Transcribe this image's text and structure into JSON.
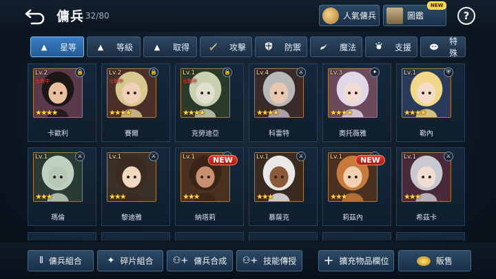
{
  "header": {
    "title": "傭兵",
    "count": "32/80",
    "popular_label": "人氣傭兵",
    "dictionary_label": "圖鑑",
    "new_tag": "NEW",
    "help_label": "?"
  },
  "tabs": [
    {
      "label": "星等",
      "icon": "arrow-up-icon",
      "active": true
    },
    {
      "label": "等級",
      "icon": "arrow-up-icon",
      "active": false
    },
    {
      "label": "取得",
      "icon": "arrow-up-icon",
      "active": false
    },
    {
      "label": "攻擊",
      "icon": "sword-icon",
      "active": false
    },
    {
      "label": "防禦",
      "icon": "shield-icon",
      "active": false
    },
    {
      "label": "魔法",
      "icon": "magic-icon",
      "active": false
    },
    {
      "label": "支援",
      "icon": "support-icon",
      "active": false
    },
    {
      "label": "特殊",
      "icon": "special-icon",
      "active": false
    }
  ],
  "cards": [
    {
      "name": "卡歐利",
      "level": "Lv.2",
      "status": "出戰中",
      "stars": 4,
      "role_icon": "lock-icon",
      "new": "",
      "hair": "#1c1616",
      "skin": "#e8c0a0",
      "bg": "#5a3a4a"
    },
    {
      "name": "賽爾",
      "level": "Lv.2",
      "status": "出戰中",
      "stars": 4,
      "role_icon": "lock-icon",
      "new": "",
      "hair": "#d8c890",
      "skin": "#f0d0b8",
      "bg": "#4a3028"
    },
    {
      "name": "克勞迪亞",
      "level": "Lv.1",
      "status": "出戰中",
      "stars": 4,
      "role_icon": "lock-icon",
      "new": "",
      "hair": "#c8d0b0",
      "skin": "#e0e0d0",
      "bg": "#2a3a2a"
    },
    {
      "name": "科雷特",
      "level": "Lv.4",
      "status": "",
      "stars": 4,
      "role_icon": "sword-icon",
      "new": "",
      "hair": "#b8b8b8",
      "skin": "#e8c8b0",
      "bg": "#3a2a2a"
    },
    {
      "name": "奧托薇雅",
      "level": "Lv.3",
      "status": "",
      "stars": 4,
      "role_icon": "magic-icon",
      "new": "",
      "hair": "#e0d8e8",
      "skin": "#f0dcd0",
      "bg": "#6a4a5a"
    },
    {
      "name": "勒內",
      "level": "Lv.1",
      "status": "",
      "stars": 4,
      "role_icon": "shield-icon",
      "new": "",
      "hair": "#f0d888",
      "skin": "#f4dcc8",
      "bg": "#2a3a5a"
    },
    {
      "name": "瑪倫",
      "level": "Lv.1",
      "status": "",
      "stars": 3,
      "role_icon": "sword-icon",
      "new": "",
      "hair": "#c0d0c0",
      "skin": "#b8c8b8",
      "bg": "#2a3a34"
    },
    {
      "name": "黎迪雅",
      "level": "Lv.1",
      "status": "",
      "stars": 3,
      "role_icon": "sword-icon",
      "new": "",
      "hair": "#3a2a20",
      "skin": "#f0d8c0",
      "bg": "#3a3028"
    },
    {
      "name": "納塔莉",
      "level": "Lv.1",
      "status": "",
      "stars": 3,
      "role_icon": "sword-icon",
      "new": "NEW",
      "hair": "#3a2418",
      "skin": "#c89070",
      "bg": "#4a3020"
    },
    {
      "name": "慕薩克",
      "level": "Lv.1",
      "status": "",
      "stars": 3,
      "role_icon": "sword-icon",
      "new": "",
      "hair": "#e8e8e8",
      "skin": "#8a5a3a",
      "bg": "#3a2a20"
    },
    {
      "name": "莉茲內",
      "level": "Lv.1",
      "status": "",
      "stars": 3,
      "role_icon": "sword-icon",
      "new": "NEW",
      "hair": "#c87a3a",
      "skin": "#f0d0b0",
      "bg": "#4a3020"
    },
    {
      "name": "希茲卡",
      "level": "Lv.1",
      "status": "",
      "stars": 3,
      "role_icon": "sword-icon",
      "new": "",
      "hair": "#c8c8d0",
      "skin": "#f0dcd0",
      "bg": "#4a2a3a"
    }
  ],
  "bottom": {
    "combine_label": "傭兵組合",
    "shard_label": "碎片組合",
    "synth_label": "傭兵合成",
    "skill_label": "技能傳授",
    "expand_label": "擴充物品欄位",
    "sell_label": "販售"
  },
  "colors": {
    "accent": "#3a7ec4",
    "star": "#ffd24a",
    "status": "#ff4a4a",
    "new_badge": "#e23a2a"
  }
}
